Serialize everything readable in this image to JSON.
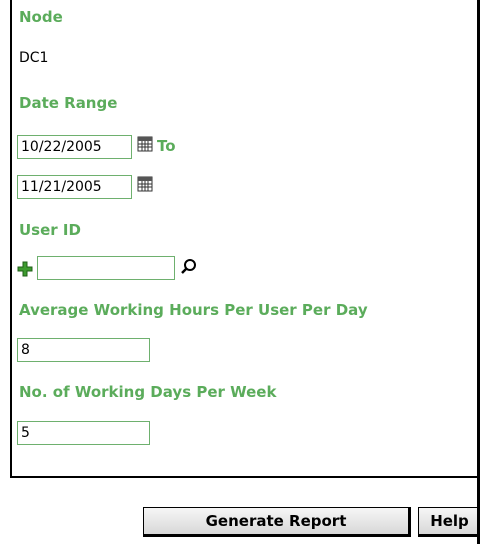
{
  "node": {
    "label": "Node",
    "value": "DC1"
  },
  "date_range": {
    "label": "Date Range",
    "from_value": "10/22/2005",
    "to_label": "To",
    "to_value": "11/21/2005"
  },
  "user_id": {
    "label": "User ID",
    "value": ""
  },
  "avg_hours": {
    "label": "Average Working Hours Per User Per Day",
    "value": "8"
  },
  "working_days": {
    "label": "No. of Working Days Per Week",
    "value": "5"
  },
  "buttons": {
    "generate": "Generate Report",
    "help": "Help"
  },
  "colors": {
    "label_green": "#5bac5b",
    "field_border": "#6eb06e"
  },
  "icons": [
    "calendar-icon",
    "add-icon",
    "search-icon"
  ]
}
